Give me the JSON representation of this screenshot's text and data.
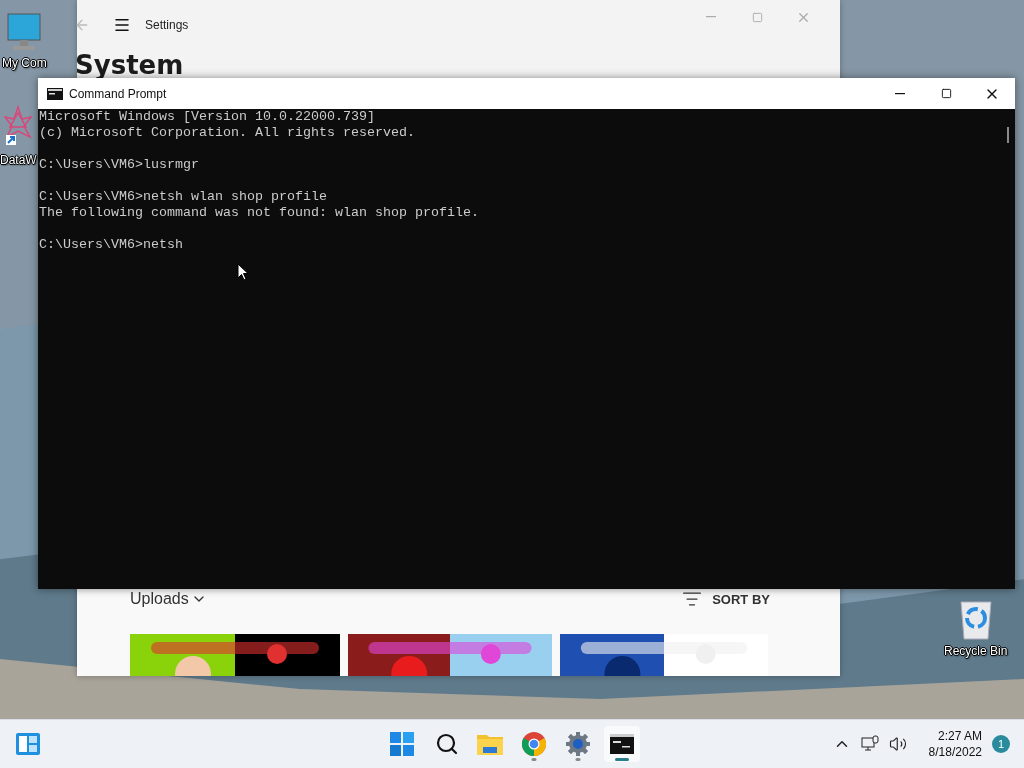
{
  "desktop_icons": [
    {
      "kind": "computer",
      "label": "My Com"
    },
    {
      "kind": "shortcut",
      "label": "DataW"
    },
    {
      "kind": "recycle",
      "label": "Recycle Bin"
    }
  ],
  "back_window": {
    "title": "Settings",
    "heading": "System",
    "section_label": "Uploads",
    "sort_label": "SORT BY"
  },
  "console": {
    "title": "Command Prompt",
    "blocks": [
      [
        "Microsoft Windows [Version 10.0.22000.739]",
        "(c) Microsoft Corporation. All rights reserved."
      ],
      [
        "C:\\Users\\VM6>lusrmgr"
      ],
      [
        "C:\\Users\\VM6>netsh wlan shop profile",
        "The following command was not found: wlan shop profile."
      ],
      [
        "C:\\Users\\VM6>netsh"
      ]
    ]
  },
  "taskbar": {
    "apps": [
      {
        "kind": "start",
        "running": false,
        "active": false
      },
      {
        "kind": "search",
        "running": false,
        "active": false
      },
      {
        "kind": "explorer",
        "running": false,
        "active": false
      },
      {
        "kind": "chrome",
        "running": true,
        "active": false
      },
      {
        "kind": "settings",
        "running": true,
        "active": false
      },
      {
        "kind": "terminal",
        "running": true,
        "active": true
      }
    ],
    "time": "2:27 AM",
    "date": "8/18/2022",
    "notification_count": "1"
  }
}
